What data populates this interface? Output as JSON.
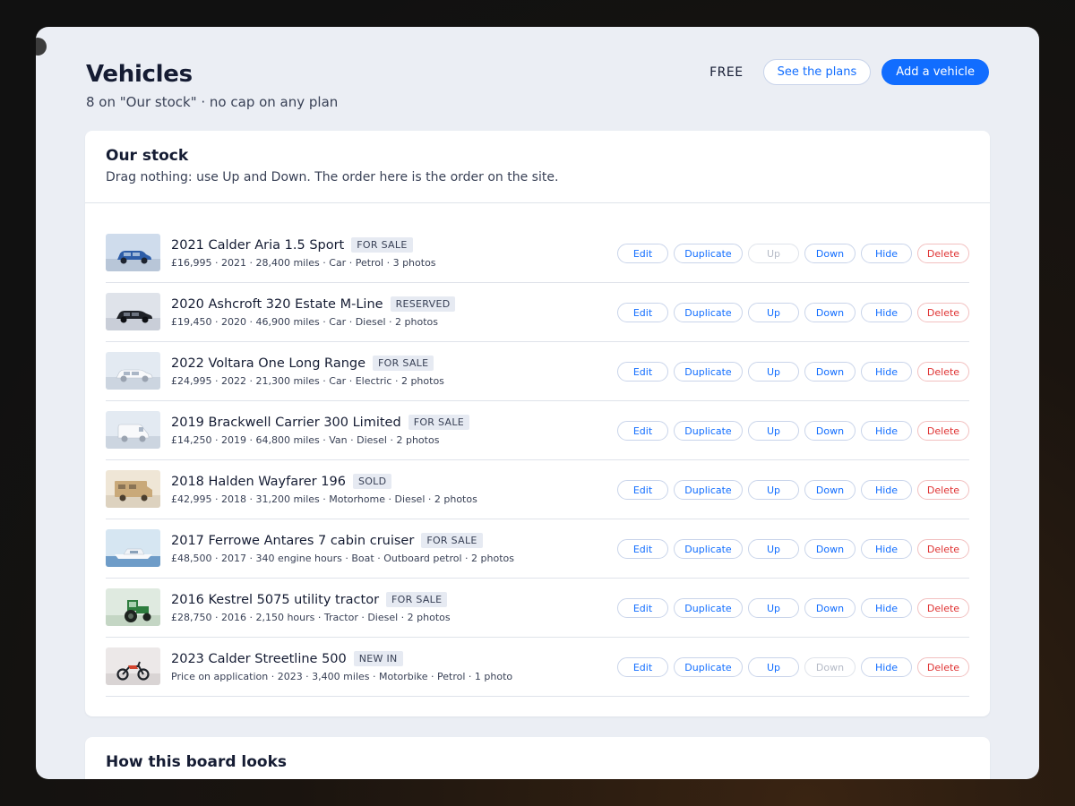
{
  "header": {
    "title": "Vehicles",
    "subtitle": "8 on \"Our stock\" · no cap on any plan",
    "plan": "FREE",
    "see_plans": "See the plans",
    "add_vehicle": "Add a vehicle"
  },
  "stock": {
    "title": "Our stock",
    "subtitle": "Drag nothing: use Up and Down. The order here is the order on the site.",
    "actions": {
      "edit": "Edit",
      "duplicate": "Duplicate",
      "up": "Up",
      "down": "Down",
      "hide": "Hide",
      "delete": "Delete"
    },
    "vehicles": [
      {
        "title": "2021 Calder Aria 1.5 Sport",
        "status": "FOR SALE",
        "meta": "£16,995 · 2021 · 28,400 miles · Car · Petrol · 3 photos",
        "thumb": "car-blue",
        "up_disabled": true,
        "down_disabled": false
      },
      {
        "title": "2020 Ashcroft 320 Estate M-Line",
        "status": "RESERVED",
        "meta": "£19,450 · 2020 · 46,900 miles · Car · Diesel · 2 photos",
        "thumb": "car-black",
        "up_disabled": false,
        "down_disabled": false
      },
      {
        "title": "2022 Voltara One Long Range",
        "status": "FOR SALE",
        "meta": "£24,995 · 2022 · 21,300 miles · Car · Electric · 2 photos",
        "thumb": "car-white",
        "up_disabled": false,
        "down_disabled": false
      },
      {
        "title": "2019 Brackwell Carrier 300 Limited",
        "status": "FOR SALE",
        "meta": "£14,250 · 2019 · 64,800 miles · Van · Diesel · 2 photos",
        "thumb": "van-white",
        "up_disabled": false,
        "down_disabled": false
      },
      {
        "title": "2018 Halden Wayfarer 196",
        "status": "SOLD",
        "meta": "£42,995 · 2018 · 31,200 miles · Motorhome · Diesel · 2 photos",
        "thumb": "motorhome",
        "up_disabled": false,
        "down_disabled": false
      },
      {
        "title": "2017 Ferrowe Antares 7 cabin cruiser",
        "status": "FOR SALE",
        "meta": "£48,500 · 2017 · 340 engine hours · Boat · Outboard petrol · 2 photos",
        "thumb": "boat",
        "up_disabled": false,
        "down_disabled": false
      },
      {
        "title": "2016 Kestrel 5075 utility tractor",
        "status": "FOR SALE",
        "meta": "£28,750 · 2016 · 2,150 hours · Tractor · Diesel · 2 photos",
        "thumb": "tractor",
        "up_disabled": false,
        "down_disabled": false
      },
      {
        "title": "2023 Calder Streetline 500",
        "status": "NEW IN",
        "meta": "Price on application · 2023 · 3,400 miles · Motorbike · Petrol · 1 photo",
        "thumb": "motorbike",
        "up_disabled": false,
        "down_disabled": true
      }
    ]
  },
  "preview": {
    "title": "How this board looks"
  },
  "colors": {
    "accent": "#116dff",
    "danger": "#df3131",
    "text": "#151c33",
    "page_bg": "#ebeef4"
  }
}
